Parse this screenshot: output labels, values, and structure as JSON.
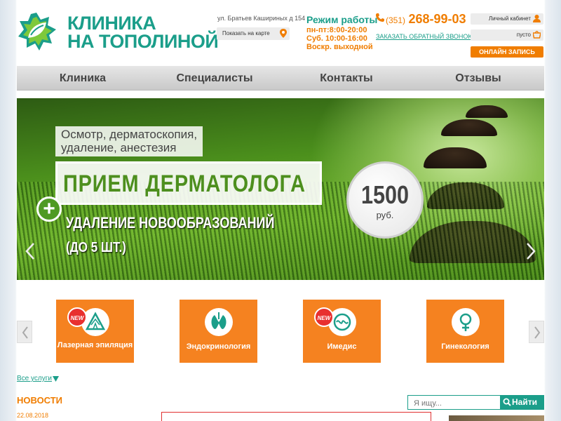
{
  "header": {
    "logo_line1": "КЛИНИКА",
    "logo_line2": "НА ТОПОЛИНОЙ",
    "address": "ул. Братьев Кашириных д 154",
    "map_button": "Показать на карте",
    "hours_title": "Режим работы",
    "hours": [
      "пн-пт:8:00-20:00",
      "Суб. 10:00-16:00",
      "Воскр. выходной"
    ],
    "phone_code": "(351)",
    "phone_number": "268-99-03",
    "callback_link": "ЗАКАЗАТЬ ОБРАТНЫЙ ЗВОНОК",
    "account_button": "Личный кабинет",
    "cart_button": "пусто",
    "appointment_button": "ОНЛАЙН ЗАПИСЬ"
  },
  "nav": {
    "items": [
      "Клиника",
      "Специалисты",
      "Контакты",
      "Отзывы"
    ]
  },
  "banner": {
    "subtitle_line1": "Осмотр, дерматоскопия,",
    "subtitle_line2": "удаление, анестезия",
    "title": "ПРИЕМ ДЕРМАТОЛОГА",
    "plus": "+",
    "line2": "УДАЛЕНИЕ НОВООБРАЗОВАНИЙ",
    "line3": "(ДО 5 ШТ.)",
    "price": "1500",
    "currency": "руб."
  },
  "services": {
    "new_badge": "NEW",
    "items": [
      {
        "label": "Лазерная эпиляция",
        "is_new": true,
        "icon": "laser-icon"
      },
      {
        "label": "Эндокринология",
        "is_new": false,
        "icon": "thyroid-icon"
      },
      {
        "label": "Имедис",
        "is_new": true,
        "icon": "imedis-icon"
      },
      {
        "label": "Гинекология",
        "is_new": false,
        "icon": "female-icon"
      }
    ],
    "all_link": "Все услуги"
  },
  "news": {
    "title": "НОВОСТИ",
    "date": "22.08.2018"
  },
  "search": {
    "placeholder": "Я ищу...",
    "button": "Найти"
  },
  "colors": {
    "brand_green": "#1b9e8a",
    "brand_orange": "#f07d00"
  }
}
